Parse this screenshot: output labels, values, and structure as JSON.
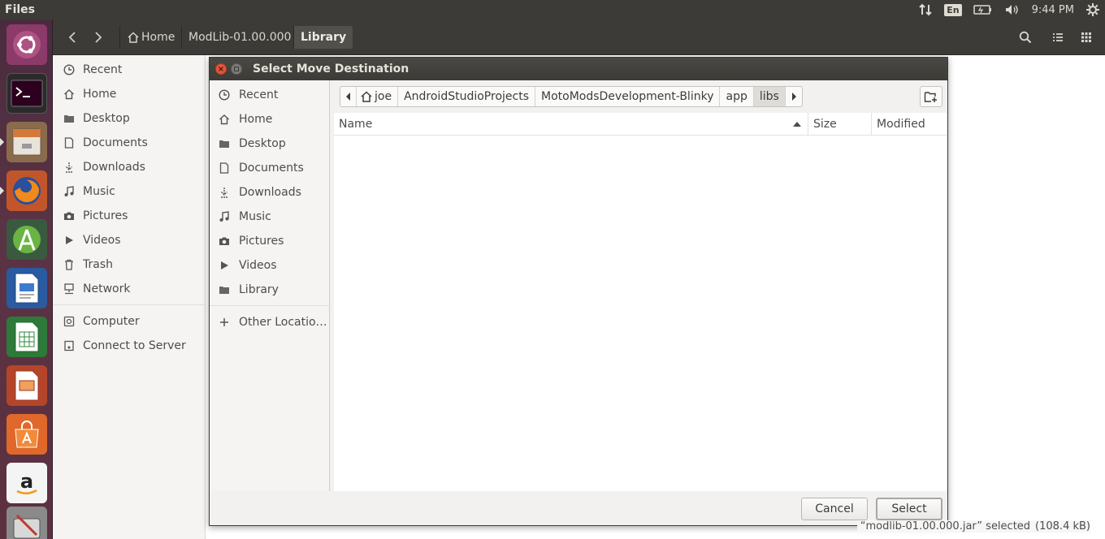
{
  "topbar": {
    "app_title": "Files",
    "keyboard_layout": "En",
    "clock": "9:44 PM",
    "icons": [
      "network-transfer-icon",
      "battery-icon",
      "volume-icon",
      "settings-gear-icon"
    ]
  },
  "launcher": {
    "items": [
      "ubuntu-dash",
      "terminal",
      "files",
      "firefox",
      "android-studio",
      "libreoffice-writer",
      "libreoffice-calc",
      "libreoffice-impress",
      "ubuntu-software",
      "amazon",
      "system-tools"
    ]
  },
  "header": {
    "breadcrumbs": [
      "Home",
      "ModLib-01.00.000",
      "Library"
    ]
  },
  "sidebar": {
    "items": [
      {
        "label": "Recent",
        "icon": "clock-icon"
      },
      {
        "label": "Home",
        "icon": "home-icon"
      },
      {
        "label": "Desktop",
        "icon": "folder-icon"
      },
      {
        "label": "Documents",
        "icon": "document-icon"
      },
      {
        "label": "Downloads",
        "icon": "download-icon"
      },
      {
        "label": "Music",
        "icon": "music-icon"
      },
      {
        "label": "Pictures",
        "icon": "camera-icon"
      },
      {
        "label": "Videos",
        "icon": "video-icon"
      },
      {
        "label": "Trash",
        "icon": "trash-icon"
      },
      {
        "label": "Network",
        "icon": "network-icon"
      }
    ],
    "items2": [
      {
        "label": "Computer",
        "icon": "computer-icon"
      },
      {
        "label": "Connect to Server",
        "icon": "server-icon"
      }
    ]
  },
  "dialog": {
    "title": "Select Move Destination",
    "sidebar": [
      {
        "label": "Recent",
        "icon": "clock-icon"
      },
      {
        "label": "Home",
        "icon": "home-icon"
      },
      {
        "label": "Desktop",
        "icon": "folder-icon"
      },
      {
        "label": "Documents",
        "icon": "document-icon"
      },
      {
        "label": "Downloads",
        "icon": "download-icon"
      },
      {
        "label": "Music",
        "icon": "music-icon"
      },
      {
        "label": "Pictures",
        "icon": "camera-icon"
      },
      {
        "label": "Videos",
        "icon": "video-icon"
      },
      {
        "label": "Library",
        "icon": "folder-icon"
      },
      {
        "label": "Other Locatio…",
        "icon": "plus-icon"
      }
    ],
    "path": [
      "joe",
      "AndroidStudioProjects",
      "MotoModsDevelopment-Blinky",
      "app",
      "libs"
    ],
    "columns": {
      "name": "Name",
      "size": "Size",
      "modified": "Modified"
    },
    "buttons": {
      "cancel": "Cancel",
      "select": "Select"
    }
  },
  "status": {
    "selection": "“modlib-01.00.000.jar” selected",
    "size": "(108.4 kB)"
  },
  "colors": {
    "panel": "#3c3b37",
    "launcher": "#5a3344",
    "close_button": "#e6553a"
  }
}
